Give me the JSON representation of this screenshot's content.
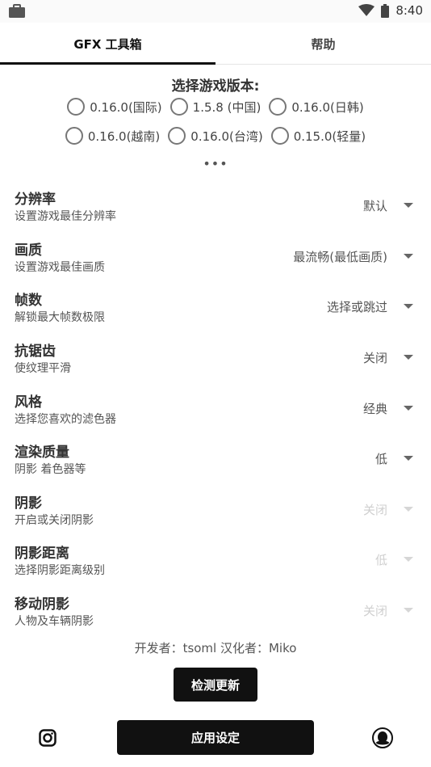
{
  "status_bar": {
    "time": "8:40",
    "left_icon": "briefcase-icon",
    "right_icons": [
      "wifi-icon",
      "battery-icon"
    ]
  },
  "tabs": [
    {
      "label": "GFX 工具箱",
      "active": true
    },
    {
      "label": "帮助",
      "active": false
    }
  ],
  "version": {
    "title": "选择游戏版本:",
    "options": [
      "0.16.0(国际)",
      "1.5.8 (中国)",
      "0.16.0(日韩)",
      "0.16.0(越南)",
      "0.16.0(台湾)",
      "0.15.0(轻量)"
    ],
    "more": "•••"
  },
  "settings": [
    {
      "title": "分辨率",
      "subtitle": "设置游戏最佳分辨率",
      "value": "默认",
      "enabled": true
    },
    {
      "title": "画质",
      "subtitle": "设置游戏最佳画质",
      "value": "最流畅(最低画质)",
      "enabled": true
    },
    {
      "title": "帧数",
      "subtitle": "解锁最大帧数极限",
      "value": "选择或跳过",
      "enabled": true
    },
    {
      "title": "抗锯齿",
      "subtitle": "使纹理平滑",
      "value": "关闭",
      "enabled": true
    },
    {
      "title": "风格",
      "subtitle": "选择您喜欢的滤色器",
      "value": "经典",
      "enabled": true
    },
    {
      "title": "渲染质量",
      "subtitle": "阴影 着色器等",
      "value": "低",
      "enabled": true
    },
    {
      "title": "阴影",
      "subtitle": "开启或关闭阴影",
      "value": "关闭",
      "enabled": false
    },
    {
      "title": "阴影距离",
      "subtitle": "选择阴影距离级别",
      "value": "低",
      "enabled": false
    },
    {
      "title": "移动阴影",
      "subtitle": "人物及车辆阴影",
      "value": "关闭",
      "enabled": false
    }
  ],
  "credits": "开发者：tsoml   汉化者：Miko",
  "check_update_label": "检测更新",
  "apply_label": "应用设定",
  "bottom_icons": {
    "left": "instagram-icon",
    "right": "qq-icon"
  }
}
